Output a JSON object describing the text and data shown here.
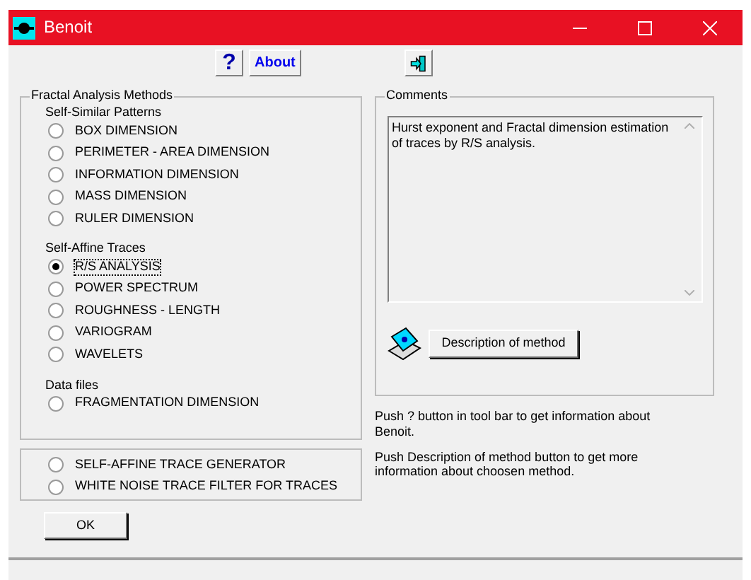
{
  "window": {
    "title": "Benoit",
    "controls": [
      {
        "kind": "minimize"
      },
      {
        "kind": "maximize"
      },
      {
        "kind": "close"
      }
    ]
  },
  "toolbar": [
    {
      "kind": "help",
      "label": "?"
    },
    {
      "kind": "about",
      "label": "About"
    },
    {
      "kind": "exit"
    }
  ],
  "methods": {
    "title": "Fractal Analysis Methods",
    "groups": [
      {
        "label": "Self-Similar Patterns",
        "options": [
          {
            "label": "BOX DIMENSION",
            "selected": false
          },
          {
            "label": "PERIMETER - AREA DIMENSION",
            "selected": false
          },
          {
            "label": "INFORMATION DIMENSION",
            "selected": false
          },
          {
            "label": "MASS DIMENSION",
            "selected": false
          },
          {
            "label": "RULER DIMENSION",
            "selected": false
          }
        ]
      },
      {
        "label": "Self-Affine Traces",
        "options": [
          {
            "label": "R/S ANALYSIS",
            "selected": true
          },
          {
            "label": "POWER SPECTRUM",
            "selected": false
          },
          {
            "label": "ROUGHNESS - LENGTH",
            "selected": false
          },
          {
            "label": "VARIOGRAM",
            "selected": false
          },
          {
            "label": "WAVELETS",
            "selected": false
          }
        ]
      },
      {
        "label": "Data files",
        "options": [
          {
            "label": "FRAGMENTATION DIMENSION",
            "selected": false
          }
        ]
      }
    ]
  },
  "tools": [
    {
      "label": "SELF-AFFINE TRACE GENERATOR",
      "selected": false
    },
    {
      "label": "WHITE NOISE TRACE FILTER FOR TRACES",
      "selected": false
    }
  ],
  "ok_button": "OK",
  "comments": {
    "title": "Comments",
    "text": "Hurst exponent and Fractal dimension estimation of traces  by R/S analysis."
  },
  "description_button": "Description of method",
  "hints": [
    "Push ? button in tool bar to get information about Benoit.",
    "Push Description of method button to get more information about choosen method."
  ]
}
